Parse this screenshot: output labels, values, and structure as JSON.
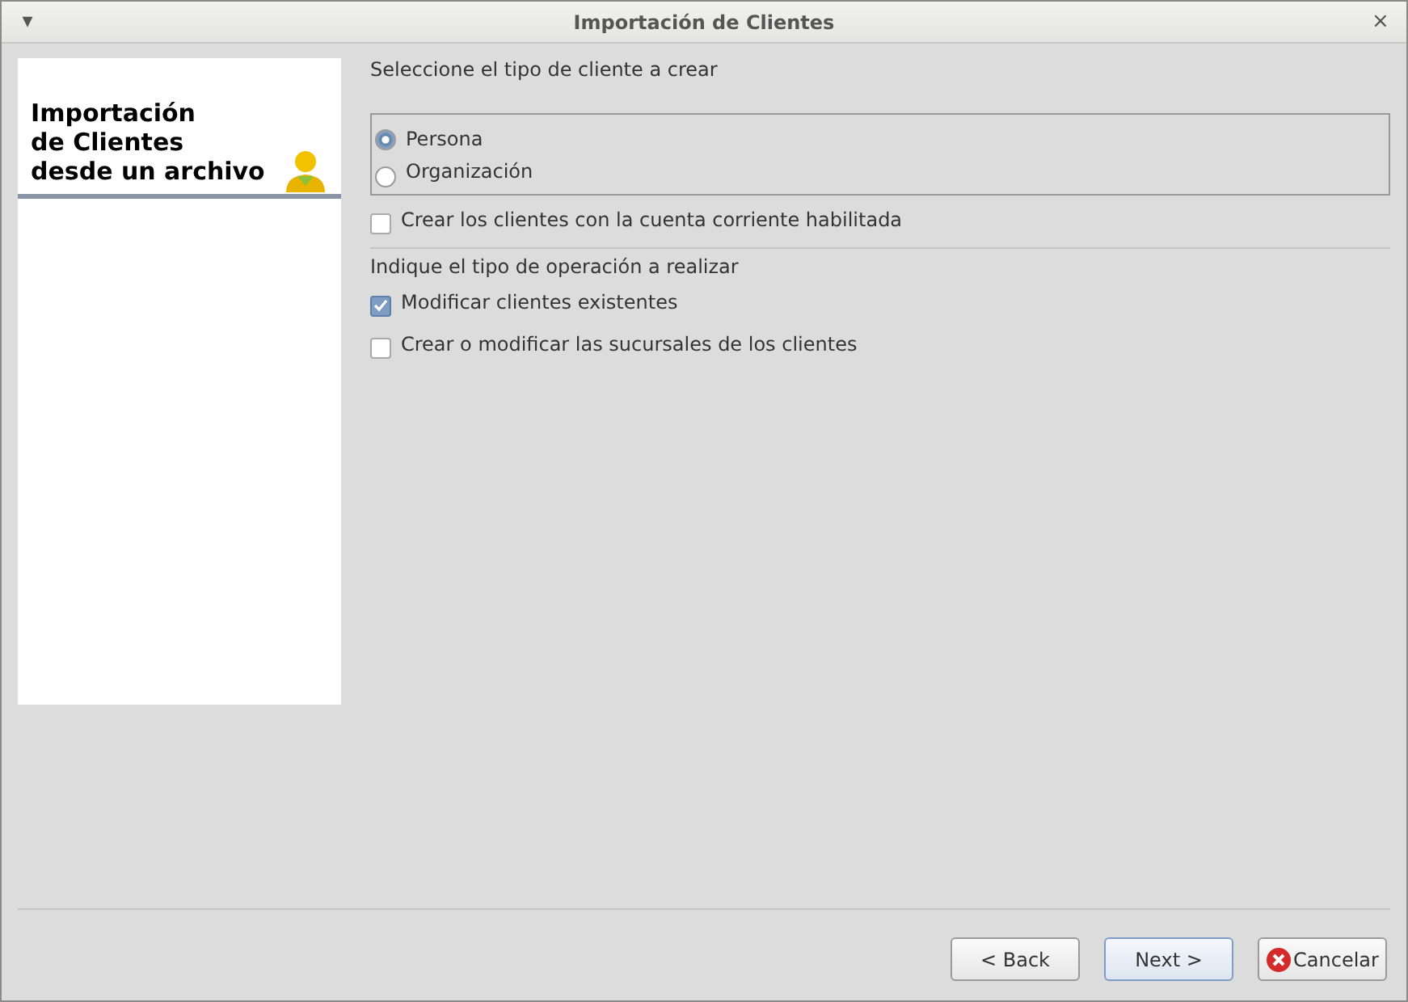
{
  "window": {
    "title": "Importación de Clientes",
    "menu_glyph": "▾",
    "close_glyph": "×"
  },
  "sidebar": {
    "title_lines": [
      "Importación",
      "de Clientes",
      "desde un archivo"
    ]
  },
  "client_type": {
    "label": "Seleccione el tipo de cliente a crear",
    "options": [
      {
        "label": "Persona",
        "selected": true
      },
      {
        "label": "Organización",
        "selected": false
      }
    ]
  },
  "account_option": {
    "label": "Crear los clientes con la cuenta corriente habilitada",
    "checked": false
  },
  "operation": {
    "label": "Indique el tipo de operación a realizar",
    "options": [
      {
        "label": "Modificar clientes existentes",
        "checked": true
      },
      {
        "label": "Crear o modificar las sucursales de los clientes",
        "checked": false
      }
    ]
  },
  "buttons": [
    {
      "label": "< Back",
      "kind": "plain",
      "focused": false
    },
    {
      "label": "Next >",
      "kind": "plain",
      "focused": true
    },
    {
      "label": "Cancelar",
      "kind": "cancel",
      "focused": false
    }
  ]
}
